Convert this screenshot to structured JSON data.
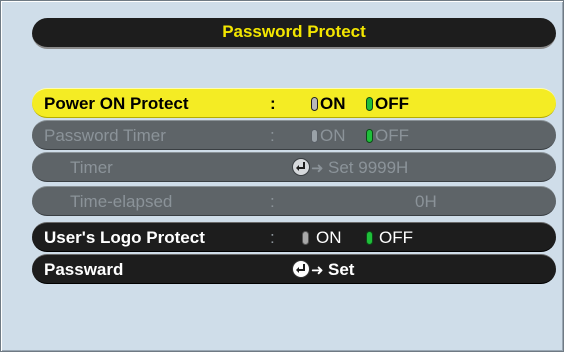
{
  "title": "Password Protect",
  "rows": [
    {
      "label": "Power ON Protect",
      "colon": ":",
      "on": "ON",
      "off": "OFF"
    },
    {
      "label": "Password Timer",
      "colon": ":",
      "on": "ON",
      "off": "OFF"
    },
    {
      "label": "Timer",
      "value": "Set 9999H"
    },
    {
      "label": "Time-elapsed",
      "colon": ":",
      "value": "0H"
    },
    {
      "label": "User's Logo Protect",
      "colon": ":",
      "on": "ON",
      "off": "OFF"
    },
    {
      "label": "Passward",
      "value": "Set"
    }
  ],
  "colors": {
    "panel": "#cfdde9",
    "highlight": "#f4ec24",
    "title_text": "#f3e600",
    "disabled_row": "#5e6468",
    "row_dark": "#1d1d1d",
    "selected_indicator": "#1fbf3a"
  },
  "icons": [
    "enter-icon",
    "right-arrow-icon",
    "radio-pill-icon"
  ]
}
